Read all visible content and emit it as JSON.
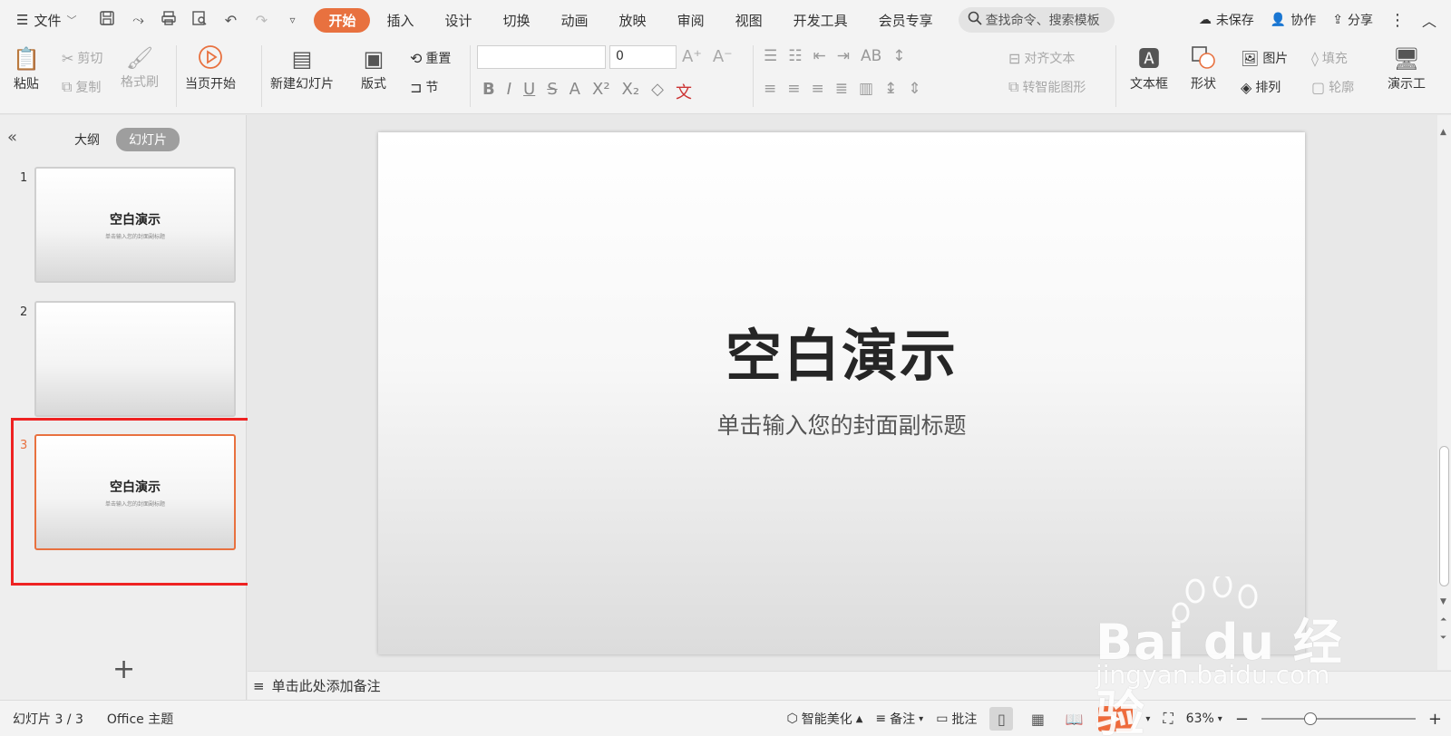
{
  "menubar": {
    "file_label": "文件",
    "tabs": [
      "开始",
      "插入",
      "设计",
      "切换",
      "动画",
      "放映",
      "审阅",
      "视图",
      "开发工具",
      "会员专享"
    ],
    "active_tab": "开始",
    "search_placeholder": "查找命令、搜索模板",
    "unsaved": "未保存",
    "collab": "协作",
    "share": "分享"
  },
  "ribbon": {
    "paste": "粘贴",
    "cut": "剪切",
    "copy": "复制",
    "format_painter": "格式刷",
    "start_from_current": "当页开始",
    "new_slide": "新建幻灯片",
    "layout": "版式",
    "reset": "重置",
    "section": "节",
    "font_size": "0",
    "align_text": "对齐文本",
    "smart_shape": "转智能图形",
    "textbox": "文本框",
    "shape": "形状",
    "picture": "图片",
    "arrange": "排列",
    "fill": "填充",
    "outline": "轮廓",
    "present": "演示工"
  },
  "leftpanel": {
    "outline_tab": "大纲",
    "slides_tab": "幻灯片",
    "thumbs": [
      {
        "num": "1",
        "title": "空白演示",
        "sub": "单击输入您的封面副标题"
      },
      {
        "num": "2",
        "title": "",
        "sub": ""
      },
      {
        "num": "3",
        "title": "空白演示",
        "sub": "单击输入您的封面副标题"
      }
    ],
    "active_index": 3
  },
  "slide": {
    "title": "空白演示",
    "subtitle": "单击输入您的封面副标题"
  },
  "notes": {
    "placeholder": "单击此处添加备注"
  },
  "status": {
    "slide_info": "幻灯片 3 / 3",
    "theme": "Office 主题",
    "beautify": "智能美化",
    "notes": "备注",
    "comments": "批注",
    "zoom": "63%",
    "zoom_fraction": 0.3
  },
  "watermark": {
    "brand": "Bai du 经验",
    "url": "jingyan.baidu.com"
  },
  "colors": {
    "accent": "#e8713f",
    "annotation": "#ee2222",
    "play": "#f06a3a"
  }
}
